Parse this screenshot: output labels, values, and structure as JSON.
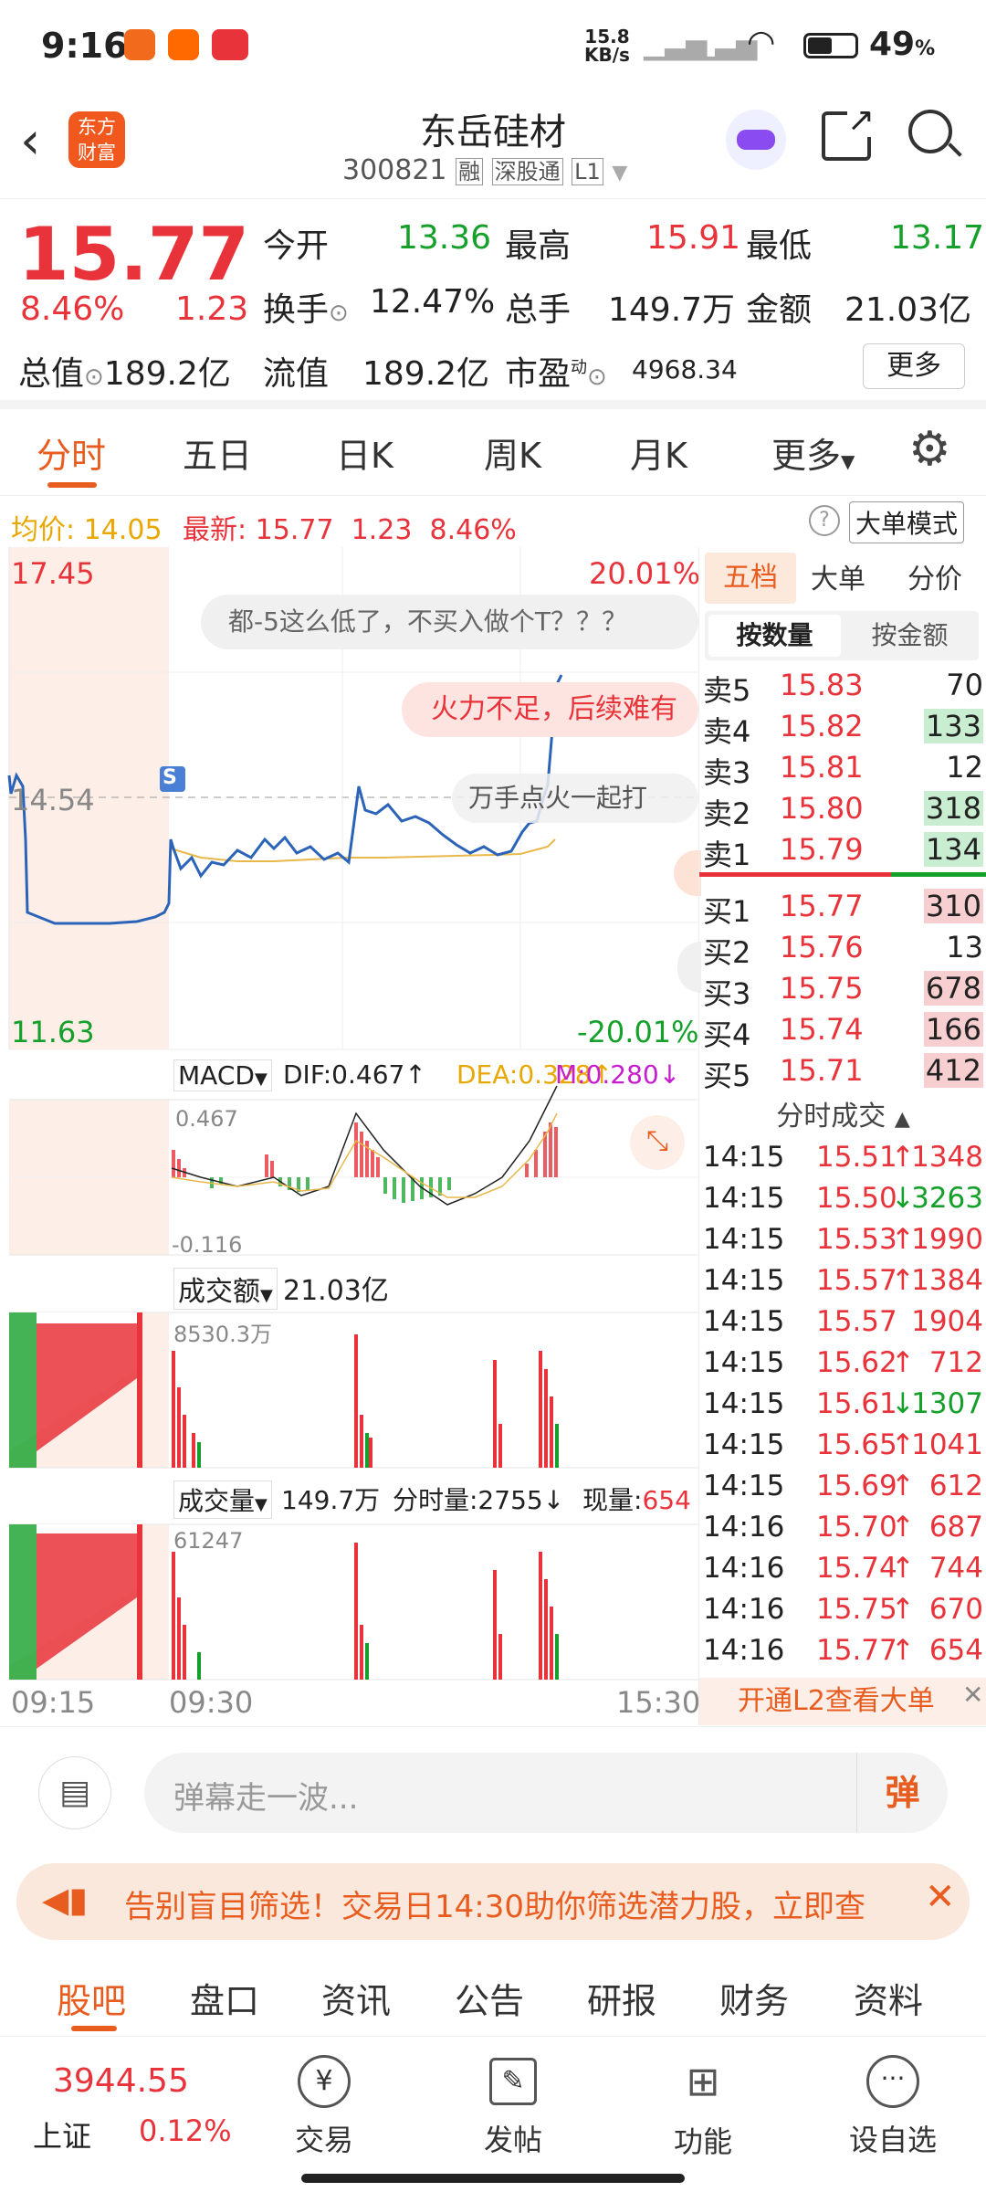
{
  "status": {
    "time": "9:16",
    "net_speed": "15.8",
    "net_unit": "KB/s",
    "battery": "49",
    "battery_unit": "%"
  },
  "header": {
    "title": "东岳硅材",
    "code": "300821",
    "tag1": "融",
    "tag2": "深股通",
    "tag3": "L1",
    "logo_line1": "东方",
    "logo_line2": "财富"
  },
  "quote": {
    "price": "15.77",
    "pct": "8.46%",
    "chg": "1.23",
    "open_label": "今开",
    "open": "13.36",
    "high_label": "最高",
    "high": "15.91",
    "low_label": "最低",
    "low": "13.17",
    "turnover_label": "换手",
    "turnover": "12.47%",
    "vol_label": "总手",
    "vol": "149.7万",
    "amount_label": "金额",
    "amount": "21.03亿",
    "mcap_label": "总值",
    "mcap": "189.2亿",
    "float_label": "流值",
    "float": "189.2亿",
    "pe_label": "市盈",
    "pe_sup": "动",
    "pe": "4968.34",
    "more": "更多"
  },
  "tabs": [
    "分时",
    "五日",
    "日K",
    "周K",
    "月K",
    "更多"
  ],
  "avgbar": {
    "avg_label": "均价:",
    "avg": "14.05",
    "latest_label": "最新:",
    "latest": "15.77",
    "chg": "1.23",
    "pct": "8.46%",
    "mode": "大单模式"
  },
  "chart": {
    "top": "17.45",
    "mid": "14.54",
    "bottom": "11.63",
    "top_pct": "20.01%",
    "bottom_pct": "-20.01%",
    "s_badge": "S",
    "danmaku": [
      "都-5这么低了，不买入做个T？？？",
      "火力不足，后续难有",
      "万手点火一起打"
    ],
    "macd": {
      "label": "MACD",
      "dif": "DIF:0.467",
      "dea": "DEA:0.328",
      "m": "M:0.280",
      "high": "0.467",
      "low": "-0.116"
    },
    "amount": {
      "label": "成交额",
      "value": "21.03亿",
      "max": "8530.3万"
    },
    "volume": {
      "label": "成交量",
      "value": "149.7万",
      "minute": "分时量:2755",
      "now_label": "现量:",
      "now": "654",
      "max": "61247"
    },
    "times": [
      "09:15",
      "09:30",
      "15:30"
    ]
  },
  "orderbook": {
    "tabs": [
      "五档",
      "大单",
      "分价"
    ],
    "sub": [
      "按数量",
      "按金额"
    ],
    "asks": [
      {
        "l": "卖5",
        "p": "15.83",
        "v": "70"
      },
      {
        "l": "卖4",
        "p": "15.82",
        "v": "133"
      },
      {
        "l": "卖3",
        "p": "15.81",
        "v": "12"
      },
      {
        "l": "卖2",
        "p": "15.80",
        "v": "318"
      },
      {
        "l": "卖1",
        "p": "15.79",
        "v": "134"
      }
    ],
    "bids": [
      {
        "l": "买1",
        "p": "15.77",
        "v": "310"
      },
      {
        "l": "买2",
        "p": "15.76",
        "v": "13"
      },
      {
        "l": "买3",
        "p": "15.75",
        "v": "678"
      },
      {
        "l": "买4",
        "p": "15.74",
        "v": "166"
      },
      {
        "l": "买5",
        "p": "15.71",
        "v": "412"
      }
    ],
    "ticks_title": "分时成交",
    "ticks": [
      {
        "t": "14:15",
        "p": "15.51",
        "a": "↑",
        "v": "1348"
      },
      {
        "t": "14:15",
        "p": "15.50",
        "a": "↓",
        "v": "3263"
      },
      {
        "t": "14:15",
        "p": "15.53",
        "a": "↑",
        "v": "1990"
      },
      {
        "t": "14:15",
        "p": "15.57",
        "a": "↑",
        "v": "1384"
      },
      {
        "t": "14:15",
        "p": "15.57",
        "a": "",
        "v": "1904"
      },
      {
        "t": "14:15",
        "p": "15.62",
        "a": "↑",
        "v": "712"
      },
      {
        "t": "14:15",
        "p": "15.61",
        "a": "↓",
        "v": "1307"
      },
      {
        "t": "14:15",
        "p": "15.65",
        "a": "↑",
        "v": "1041"
      },
      {
        "t": "14:15",
        "p": "15.69",
        "a": "↑",
        "v": "612"
      },
      {
        "t": "14:16",
        "p": "15.70",
        "a": "↑",
        "v": "687"
      },
      {
        "t": "14:16",
        "p": "15.74",
        "a": "↑",
        "v": "744"
      },
      {
        "t": "14:16",
        "p": "15.75",
        "a": "↑",
        "v": "670"
      },
      {
        "t": "14:16",
        "p": "15.77",
        "a": "↑",
        "v": "654"
      }
    ],
    "l2": "开通L2查看大单"
  },
  "comment": {
    "placeholder": "弹幕走一波...",
    "dan": "弹"
  },
  "banner": "告别盲目筛选！交易日14:30助你筛选潜力股，立即查",
  "subtabs": [
    "股吧",
    "盘口",
    "资讯",
    "公告",
    "研报",
    "财务",
    "资料"
  ],
  "bottom": {
    "index_value": "3944.55",
    "index_name": "上证",
    "index_pct": "0.12%",
    "items": [
      "交易",
      "发帖",
      "功能",
      "设自选"
    ]
  }
}
